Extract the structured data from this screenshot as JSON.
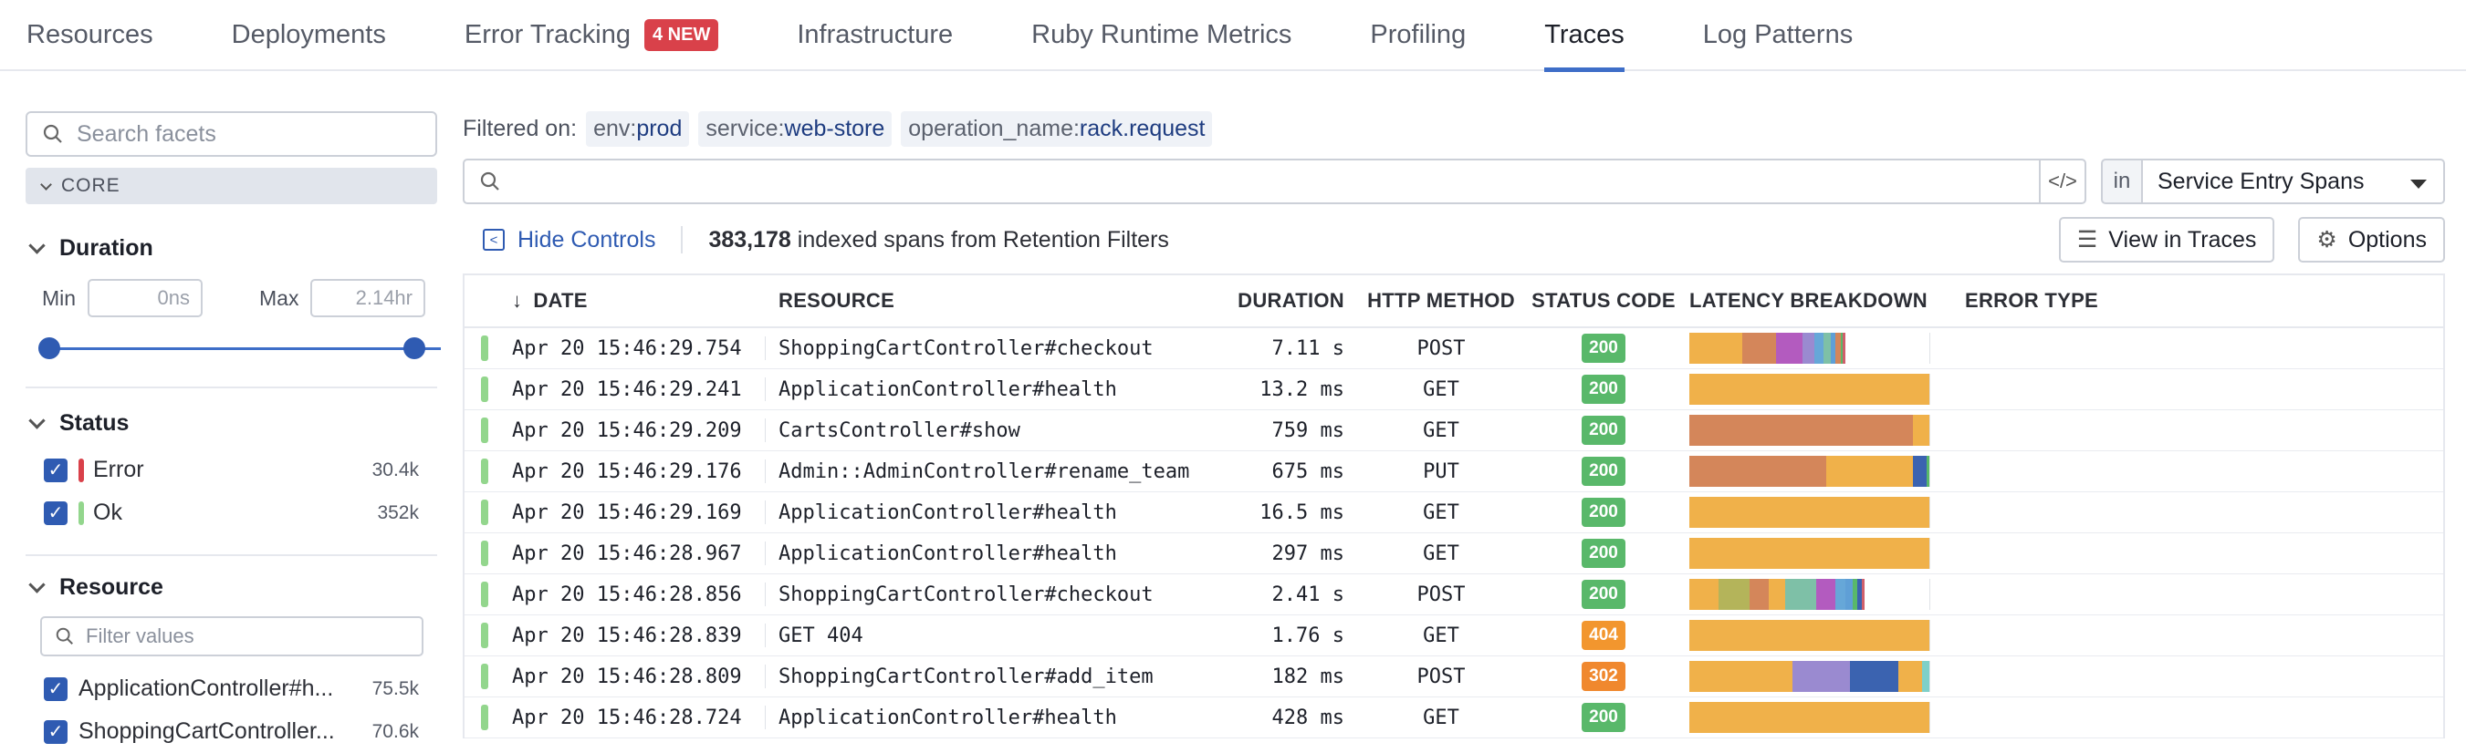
{
  "tabs": [
    {
      "label": "Resources"
    },
    {
      "label": "Deployments"
    },
    {
      "label": "Error Tracking",
      "badge": "4 NEW"
    },
    {
      "label": "Infrastructure"
    },
    {
      "label": "Ruby Runtime Metrics"
    },
    {
      "label": "Profiling"
    },
    {
      "label": "Traces",
      "active": true
    },
    {
      "label": "Log Patterns"
    }
  ],
  "sidebar": {
    "search_placeholder": "Search facets",
    "core_label": "CORE",
    "duration": {
      "title": "Duration",
      "min_label": "Min",
      "min_value": "0ns",
      "max_label": "Max",
      "max_value": "2.14hr"
    },
    "status": {
      "title": "Status",
      "items": [
        {
          "label": "Error",
          "count": "30.4k",
          "color": "#d9414a"
        },
        {
          "label": "Ok",
          "count": "352k",
          "color": "#93d68d"
        }
      ]
    },
    "resource": {
      "title": "Resource",
      "filter_placeholder": "Filter values",
      "items": [
        {
          "label": "ApplicationController#h...",
          "count": "75.5k"
        },
        {
          "label": "ShoppingCartController...",
          "count": "70.6k"
        }
      ]
    }
  },
  "filters": {
    "label": "Filtered on:",
    "pills": [
      {
        "key": "env:",
        "value": "prod"
      },
      {
        "key": "service:",
        "value": "web-store"
      },
      {
        "key": "operation_name:",
        "value": "rack.request"
      }
    ]
  },
  "query": {
    "in_label": "in",
    "scope": "Service Entry Spans"
  },
  "controls": {
    "hide_label": "Hide Controls",
    "count": "383,178",
    "count_suffix": " indexed spans from Retention Filters",
    "view_traces": "View in Traces",
    "options": "Options"
  },
  "table": {
    "headers": {
      "date": "DATE",
      "resource": "RESOURCE",
      "duration": "DURATION",
      "method": "HTTP METHOD",
      "status": "STATUS CODE",
      "latency": "LATENCY BREAKDOWN",
      "error": "ERROR TYPE"
    },
    "rows": [
      {
        "date": "Apr 20 15:46:29.754",
        "resource": "ShoppingCartController#checkout",
        "duration": "7.11 s",
        "method": "POST",
        "code": "200",
        "lat": [
          [
            22,
            "#f0b14a"
          ],
          [
            14,
            "#d4865a"
          ],
          [
            11,
            "#b35bbf"
          ],
          [
            5,
            "#9a8ad0"
          ],
          [
            4,
            "#66a7d8"
          ],
          [
            3,
            "#7ec0a7"
          ],
          [
            2,
            "#5f9fd6"
          ],
          [
            2,
            "#d4865a"
          ],
          [
            1,
            "#59b86a"
          ],
          [
            1,
            "#cf5f6b"
          ]
        ]
      },
      {
        "date": "Apr 20 15:46:29.241",
        "resource": "ApplicationController#health",
        "duration": "13.2 ms",
        "method": "GET",
        "code": "200",
        "lat": [
          [
            100,
            "#f0b14a"
          ]
        ]
      },
      {
        "date": "Apr 20 15:46:29.209",
        "resource": "CartsController#show",
        "duration": "759 ms",
        "method": "GET",
        "code": "200",
        "lat": [
          [
            93,
            "#d4865a"
          ],
          [
            7,
            "#f0b14a"
          ]
        ]
      },
      {
        "date": "Apr 20 15:46:29.176",
        "resource": "Admin::AdminController#rename_team",
        "duration": "675 ms",
        "method": "PUT",
        "code": "200",
        "lat": [
          [
            57,
            "#d4865a"
          ],
          [
            36,
            "#f0b14a"
          ],
          [
            6,
            "#3b63b0"
          ],
          [
            1,
            "#59b86a"
          ]
        ]
      },
      {
        "date": "Apr 20 15:46:29.169",
        "resource": "ApplicationController#health",
        "duration": "16.5 ms",
        "method": "GET",
        "code": "200",
        "lat": [
          [
            100,
            "#f0b14a"
          ]
        ]
      },
      {
        "date": "Apr 20 15:46:28.967",
        "resource": "ApplicationController#health",
        "duration": "297 ms",
        "method": "GET",
        "code": "200",
        "lat": [
          [
            100,
            "#f0b14a"
          ]
        ]
      },
      {
        "date": "Apr 20 15:46:28.856",
        "resource": "ShoppingCartController#checkout",
        "duration": "2.41 s",
        "method": "POST",
        "code": "200",
        "lat": [
          [
            12,
            "#f0b14a"
          ],
          [
            13,
            "#b4b45a"
          ],
          [
            8,
            "#d4865a"
          ],
          [
            7,
            "#f0b14a"
          ],
          [
            13,
            "#7ec0a7"
          ],
          [
            8,
            "#b35bbf"
          ],
          [
            4,
            "#66a7d8"
          ],
          [
            3,
            "#5f9fd6"
          ],
          [
            2,
            "#59b86a"
          ],
          [
            2,
            "#3b63b0"
          ],
          [
            1,
            "#cf5f6b"
          ]
        ]
      },
      {
        "date": "Apr 20 15:46:28.839",
        "resource": "GET 404",
        "duration": "1.76 s",
        "method": "GET",
        "code": "404",
        "lat": [
          [
            100,
            "#f0b14a"
          ]
        ]
      },
      {
        "date": "Apr 20 15:46:28.809",
        "resource": "ShoppingCartController#add_item",
        "duration": "182 ms",
        "method": "POST",
        "code": "302",
        "lat": [
          [
            43,
            "#f0b14a"
          ],
          [
            24,
            "#9a8ad0"
          ],
          [
            20,
            "#3b63b0"
          ],
          [
            10,
            "#f0b14a"
          ],
          [
            3,
            "#7fd0c8"
          ]
        ]
      },
      {
        "date": "Apr 20 15:46:28.724",
        "resource": "ApplicationController#health",
        "duration": "428 ms",
        "method": "GET",
        "code": "200",
        "lat": [
          [
            100,
            "#f0b14a"
          ]
        ]
      }
    ]
  },
  "colors": {
    "accent": "#3e6ec8",
    "ok": "#59b86a",
    "warn_404": "#f2962e",
    "redirect_302": "#f0882e",
    "error": "#d9414a"
  }
}
